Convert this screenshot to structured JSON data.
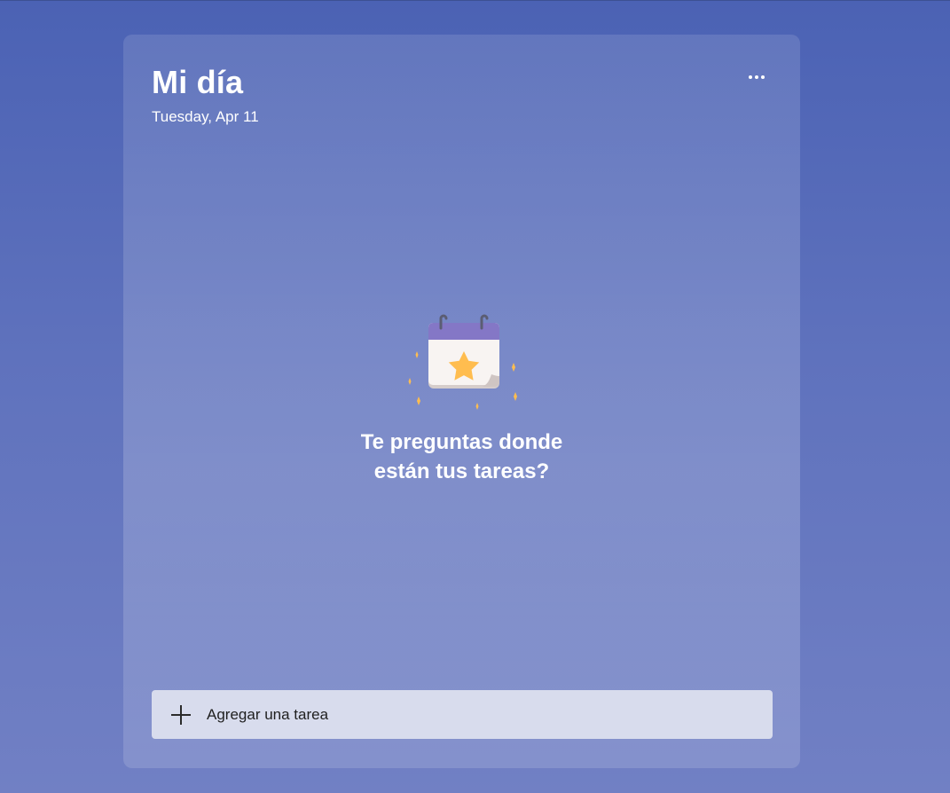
{
  "header": {
    "title": "Mi día",
    "date": "Tuesday, Apr 11"
  },
  "toolbar": {
    "more_icon": "more-horizontal-icon"
  },
  "empty_state": {
    "icon": "calendar-star-icon",
    "line1": "Te preguntas donde",
    "line2": "están tus tareas?"
  },
  "add_task": {
    "icon": "plus-icon",
    "label": "Agregar una tarea"
  },
  "colors": {
    "background_top": "#4b62b4",
    "background_bottom": "#7180c4",
    "calendar_header": "#8477c6",
    "star": "#ffbd4f",
    "add_task_bg": "#d8dced"
  }
}
